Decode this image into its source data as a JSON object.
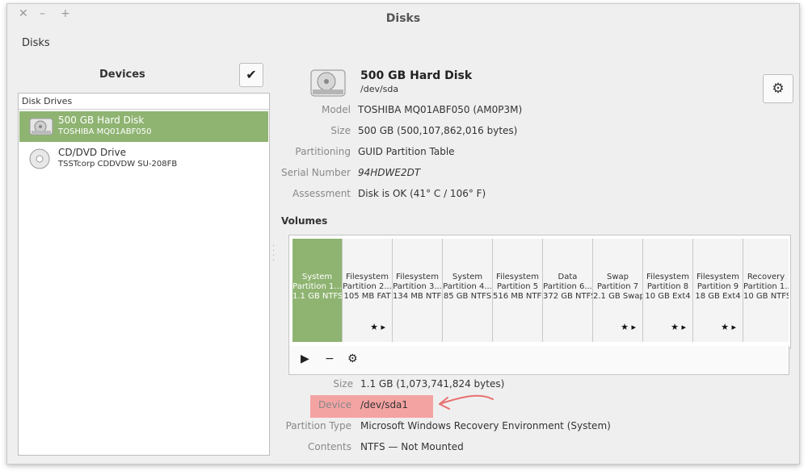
{
  "window": {
    "title": "Disks",
    "controls": [
      "✕",
      "–",
      "+"
    ],
    "menu": "Disks"
  },
  "devices": {
    "title": "Devices",
    "list_header": "Disk Drives",
    "items": [
      {
        "name": "500 GB Hard Disk",
        "sub": "TOSHIBA MQ01ABF050",
        "selected": true,
        "icon": "hard-disk-icon"
      },
      {
        "name": "CD/DVD Drive",
        "sub": "TSSTcorp CDDVDW SU-208FB",
        "selected": false,
        "icon": "optical-disc-icon"
      }
    ]
  },
  "disk": {
    "title": "500 GB Hard Disk",
    "path": "/dev/sda",
    "model_label": "Model",
    "model": "TOSHIBA MQ01ABF050 (AM0P3M)",
    "size_label": "Size",
    "size": "500 GB (500,107,862,016 bytes)",
    "partitioning_label": "Partitioning",
    "partitioning": "GUID Partition Table",
    "serial_label": "Serial Number",
    "serial": "94HDWE2DT",
    "assessment_label": "Assessment",
    "assessment": "Disk is OK (41° C / 106° F)"
  },
  "volumes": {
    "title": "Volumes",
    "segments": [
      {
        "l1": "System",
        "l2": "Partition 1...",
        "l3": "1.1 GB NTFS",
        "selected": true,
        "flags": ""
      },
      {
        "l1": "Filesystem",
        "l2": "Partition 2...",
        "l3": "105 MB FAT",
        "selected": false,
        "flags": "★ ▸"
      },
      {
        "l1": "Filesystem",
        "l2": "Partition 3...",
        "l3": "134 MB NTFS",
        "selected": false,
        "flags": ""
      },
      {
        "l1": "System",
        "l2": "Partition 4...",
        "l3": "85 GB NTFS",
        "selected": false,
        "flags": ""
      },
      {
        "l1": "Filesystem",
        "l2": "Partition 5",
        "l3": "516 MB NTFS",
        "selected": false,
        "flags": ""
      },
      {
        "l1": "Data",
        "l2": "Partition 6...",
        "l3": "372 GB NTFS",
        "selected": false,
        "flags": ""
      },
      {
        "l1": "Swap",
        "l2": "Partition 7",
        "l3": "2.1 GB Swap",
        "selected": false,
        "flags": "★ ▸"
      },
      {
        "l1": "Filesystem",
        "l2": "Partition 8",
        "l3": "10 GB Ext4",
        "selected": false,
        "flags": "★ ▸"
      },
      {
        "l1": "Filesystem",
        "l2": "Partition 9",
        "l3": "18 GB Ext4",
        "selected": false,
        "flags": "★ ▸"
      },
      {
        "l1": "Recovery",
        "l2": "Partition 1...",
        "l3": "10 GB NTFS",
        "selected": false,
        "flags": ""
      }
    ],
    "toolbar": {
      "play": "▶",
      "minus": "−",
      "gears": "⚙"
    }
  },
  "partition": {
    "size_label": "Size",
    "size": "1.1 GB (1,073,741,824 bytes)",
    "device_label": "Device",
    "device": "/dev/sda1",
    "type_label": "Partition Type",
    "type": "Microsoft Windows Recovery Environment (System)",
    "contents_label": "Contents",
    "contents": "NTFS — Not Mounted"
  },
  "colors": {
    "selection": "#8fb472",
    "highlight": "#f4a3a3",
    "arrow": "#e8706f"
  }
}
